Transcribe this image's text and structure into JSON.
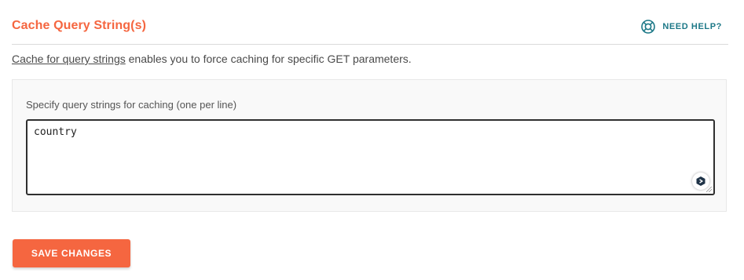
{
  "section": {
    "title": "Cache Query String(s)",
    "help_label": "NEED HELP?",
    "help_icon": "lifebuoy-icon",
    "accent_color": "#f56640",
    "help_color": "#1c7887"
  },
  "description": {
    "link_text": "Cache for query strings",
    "text": " enables you to force caching for specific GET parameters."
  },
  "query_strings_field": {
    "label": "Specify query strings for caching (one per line)",
    "value": "country",
    "assist_icon": "assistant-icon"
  },
  "actions": {
    "save_label": "SAVE CHANGES"
  }
}
